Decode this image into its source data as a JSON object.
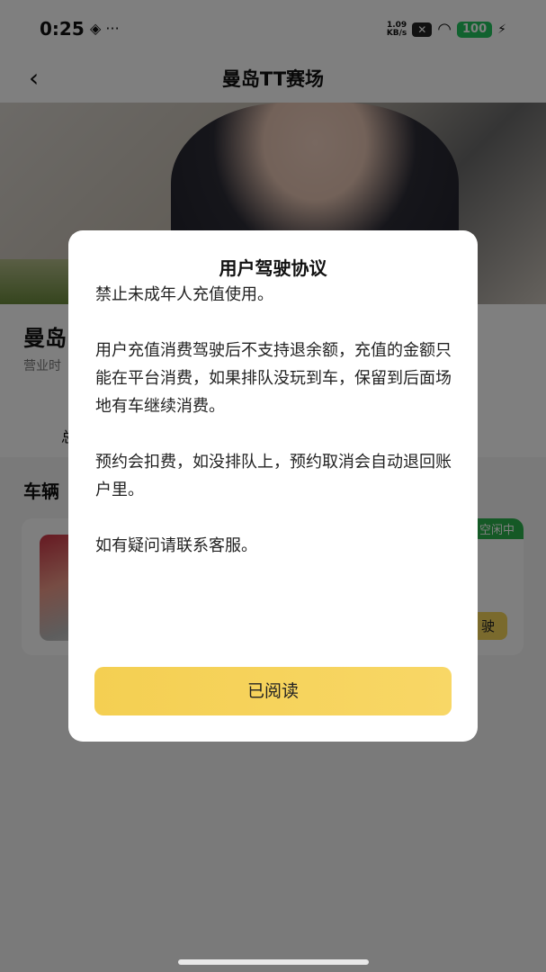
{
  "status_bar": {
    "time": "0:25",
    "left_icons": "◈ ···",
    "net_speed_value": "1.09",
    "net_speed_unit": "KB/s",
    "wifi_glyph": "◠",
    "battery": "100",
    "charging_glyph": "⚡"
  },
  "nav": {
    "back_glyph": "‹",
    "title": "曼岛TT赛场"
  },
  "venue": {
    "name": "曼岛",
    "hours_label": "营业时",
    "tab_label": "总"
  },
  "vehicles": {
    "section_title": "车辆",
    "status": "空闲中",
    "drive_label": "驶"
  },
  "modal": {
    "title": "用户驾驶协议",
    "paragraphs": [
      "禁止未成年人充值使用。",
      "用户充值消费驾驶后不支持退余额，充值的金额只能在平台消费，如果排队没玩到车，保留到后面场地有车继续消费。",
      "预约会扣费，如没排队上，预约取消会自动退回账户里。",
      "如有疑问请联系客服。"
    ],
    "button_label": "已阅读"
  },
  "colors": {
    "accent": "#f5d55a",
    "status_green": "#2bb24c",
    "battery_green": "#22c55e"
  },
  "icons": [
    "back-icon",
    "wifi-icon",
    "close-icon",
    "battery-icon",
    "charging-icon"
  ]
}
